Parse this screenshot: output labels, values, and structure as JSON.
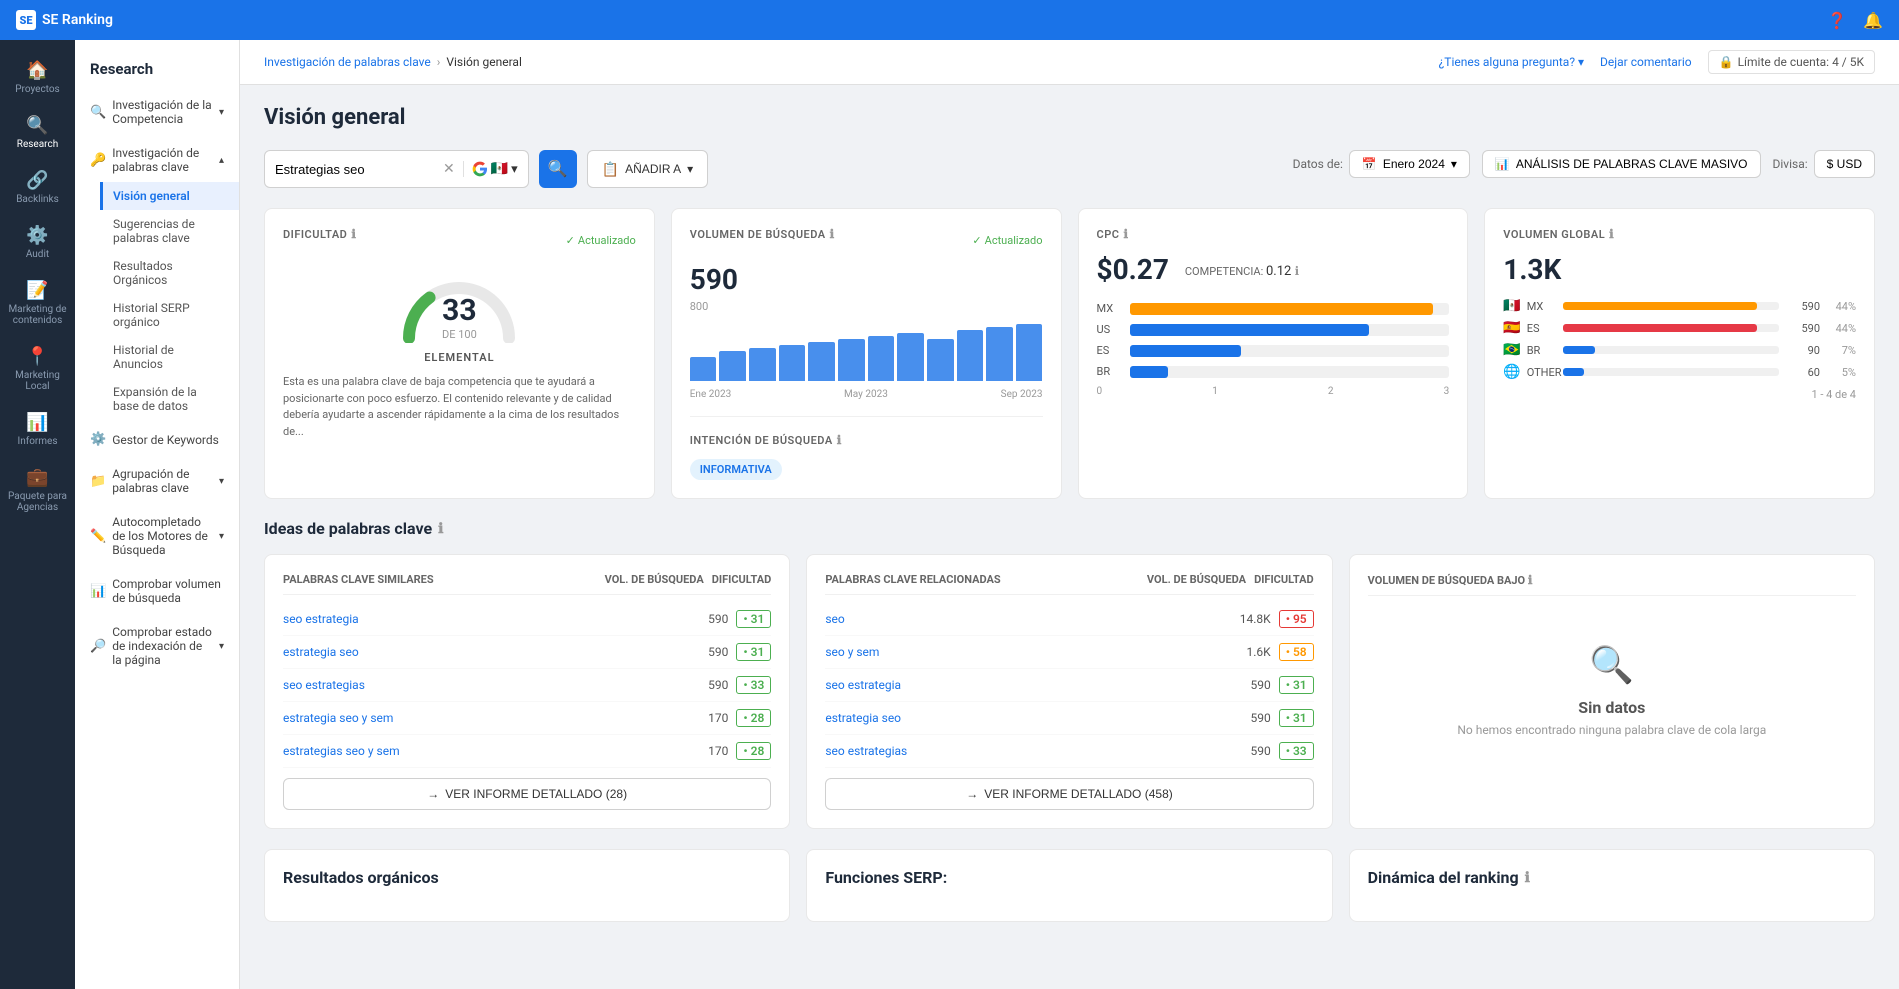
{
  "app": {
    "name": "SE Ranking"
  },
  "topbar": {
    "title": "SE Ranking",
    "help_btn": "¿Tienes alguna pregunta?",
    "comment_btn": "Dejar comentario",
    "account_limit": "Límite de cuenta: 4 / 5K"
  },
  "sidebar": {
    "items": [
      {
        "id": "proyectos",
        "label": "Proyectos",
        "icon": "🏠"
      },
      {
        "id": "research",
        "label": "Research",
        "icon": "🔍"
      },
      {
        "id": "backlinks",
        "label": "Backlinks",
        "icon": "🔗"
      },
      {
        "id": "audit",
        "label": "Audit",
        "icon": "⚙️"
      },
      {
        "id": "marketing",
        "label": "Marketing de contenidos",
        "icon": "📝"
      },
      {
        "id": "marketing-local",
        "label": "Marketing Local",
        "icon": "📍"
      },
      {
        "id": "informes",
        "label": "Informes",
        "icon": "📊"
      },
      {
        "id": "paquete",
        "label": "Paquete para Agencias",
        "icon": "💼"
      }
    ]
  },
  "left_panel": {
    "title": "Research",
    "groups": [
      {
        "id": "competencia",
        "label": "Investigación de la Competencia",
        "icon": "🔍",
        "expandable": true
      },
      {
        "id": "palabras-clave",
        "label": "Investigación de palabras clave",
        "icon": "🔑",
        "expandable": true,
        "expanded": true,
        "sub_items": [
          {
            "id": "vision-general",
            "label": "Visión general",
            "active": true
          },
          {
            "id": "sugerencias",
            "label": "Sugerencias de palabras clave"
          },
          {
            "id": "organicos",
            "label": "Resultados Orgánicos"
          },
          {
            "id": "historial-serp",
            "label": "Historial SERP orgánico"
          },
          {
            "id": "historial-anuncios",
            "label": "Historial de Anuncios"
          },
          {
            "id": "expansion",
            "label": "Expansión de la base de datos"
          }
        ]
      },
      {
        "id": "gestor",
        "label": "Gestor de Keywords",
        "icon": "⚙️",
        "expandable": false
      },
      {
        "id": "agrupacion",
        "label": "Agrupación de palabras clave",
        "icon": "📁",
        "expandable": true
      },
      {
        "id": "autocompletado",
        "label": "Autocompletado de los Motores de Búsqueda",
        "icon": "✏️",
        "expandable": true
      },
      {
        "id": "comprobar-volumen",
        "label": "Comprobar volumen de búsqueda",
        "icon": "📊",
        "expandable": false
      },
      {
        "id": "comprobar-indexacion",
        "label": "Comprobar estado de indexación de la página",
        "icon": "🔎",
        "expandable": true
      }
    ]
  },
  "breadcrumb": {
    "parent": "Investigación de palabras clave",
    "current": "Visión general"
  },
  "page": {
    "title": "Visión general",
    "search_value": "Estrategias seo",
    "add_btn": "AÑADIR A",
    "data_from": "Datos de:",
    "date": "Enero 2024",
    "analysis_btn": "ANÁLISIS DE PALABRAS CLAVE MASIVO",
    "divisa": "Divisa:",
    "currency": "$ USD"
  },
  "difficulty_card": {
    "title": "DIFICULTAD",
    "updated": "Actualizado",
    "number": "33",
    "total": "DE 100",
    "label": "ELEMENTAL",
    "description": "Esta es una palabra clave de baja competencia que te ayudará a posicionarte con poco esfuerzo. El contenido relevante y de calidad debería ayudarte a ascender rápidamente a la cima de los resultados de..."
  },
  "volume_card": {
    "title": "VOLUMEN DE BÚSQUEDA",
    "updated": "Actualizado",
    "number": "590",
    "bars": [
      40,
      50,
      55,
      60,
      65,
      70,
      75,
      80,
      70,
      85,
      90,
      95
    ],
    "labels": [
      "Ene 2023",
      "May 2023",
      "Sep 2023"
    ]
  },
  "cpc_card": {
    "title": "CPC",
    "number": "$0.27",
    "competencia_label": "COMPETENCIA:",
    "competencia_value": "0.12",
    "countries": [
      {
        "code": "MX",
        "flag": "🇲🇽",
        "pct": 95,
        "color": "mx"
      },
      {
        "code": "US",
        "flag": "🇺🇸",
        "pct": 75,
        "color": "us"
      },
      {
        "code": "ES",
        "flag": "🇪🇸",
        "pct": 35,
        "color": "es"
      },
      {
        "code": "BR",
        "flag": "🇧🇷",
        "pct": 12,
        "color": "br"
      }
    ],
    "axis_labels": [
      "0",
      "1",
      "2",
      "3"
    ]
  },
  "global_card": {
    "title": "VOLUMEN GLOBAL",
    "number": "1.3K",
    "countries": [
      {
        "code": "MX",
        "flag": "🇲🇽",
        "count": "590",
        "pct": "44%",
        "bar_pct": 90,
        "color": "mx"
      },
      {
        "code": "ES",
        "flag": "🇪🇸",
        "count": "590",
        "pct": "44%",
        "bar_pct": 90,
        "color": "es"
      },
      {
        "code": "BR",
        "flag": "🇧🇷",
        "count": "90",
        "pct": "7%",
        "bar_pct": 15,
        "color": "br"
      },
      {
        "code": "OTHER",
        "flag": "",
        "count": "60",
        "pct": "5%",
        "bar_pct": 10,
        "color": "other"
      }
    ],
    "pagination": "1 - 4 de 4"
  },
  "intencion_card": {
    "title": "INTENCIÓN DE BÚSQUEDA",
    "badge": "INFORMATIVA"
  },
  "ideas_section": {
    "title": "Ideas de palabras clave",
    "similar_col": "PALABRAS CLAVE SIMILARES",
    "related_col": "PALABRAS CLAVE RELACIONADAS",
    "low_vol_col": "VOLUMEN DE BÚSQUEDA BAJO",
    "vol_header": "VOL. DE BÚSQUEDA",
    "diff_header": "DIFICULTAD",
    "similar_items": [
      {
        "keyword": "seo estrategia",
        "vol": "590",
        "diff": "31",
        "diff_color": "green"
      },
      {
        "keyword": "estrategia seo",
        "vol": "590",
        "diff": "31",
        "diff_color": "green"
      },
      {
        "keyword": "seo estrategias",
        "vol": "590",
        "diff": "33",
        "diff_color": "green"
      },
      {
        "keyword": "estrategia seo y sem",
        "vol": "170",
        "diff": "28",
        "diff_color": "green"
      },
      {
        "keyword": "estrategias seo y sem",
        "vol": "170",
        "diff": "28",
        "diff_color": "green"
      }
    ],
    "similar_btn": "VER INFORME DETALLADO (28)",
    "related_items": [
      {
        "keyword": "seo",
        "vol": "14.8K",
        "diff": "95",
        "diff_color": "red"
      },
      {
        "keyword": "seo y sem",
        "vol": "1.6K",
        "diff": "58",
        "diff_color": "yellow"
      },
      {
        "keyword": "seo estrategia",
        "vol": "590",
        "diff": "31",
        "diff_color": "green"
      },
      {
        "keyword": "estrategia seo",
        "vol": "590",
        "diff": "31",
        "diff_color": "green"
      },
      {
        "keyword": "seo estrategias",
        "vol": "590",
        "diff": "33",
        "diff_color": "green"
      }
    ],
    "related_btn": "VER INFORME DETALLADO (458)",
    "sin_datos_title": "Sin datos",
    "sin_datos_desc": "No hemos encontrado ninguna palabra clave de cola larga"
  },
  "bottom_section": {
    "organicos_title": "Resultados orgánicos",
    "funciones_title": "Funciones SERP:",
    "dinamica_title": "Dinámica del ranking"
  }
}
